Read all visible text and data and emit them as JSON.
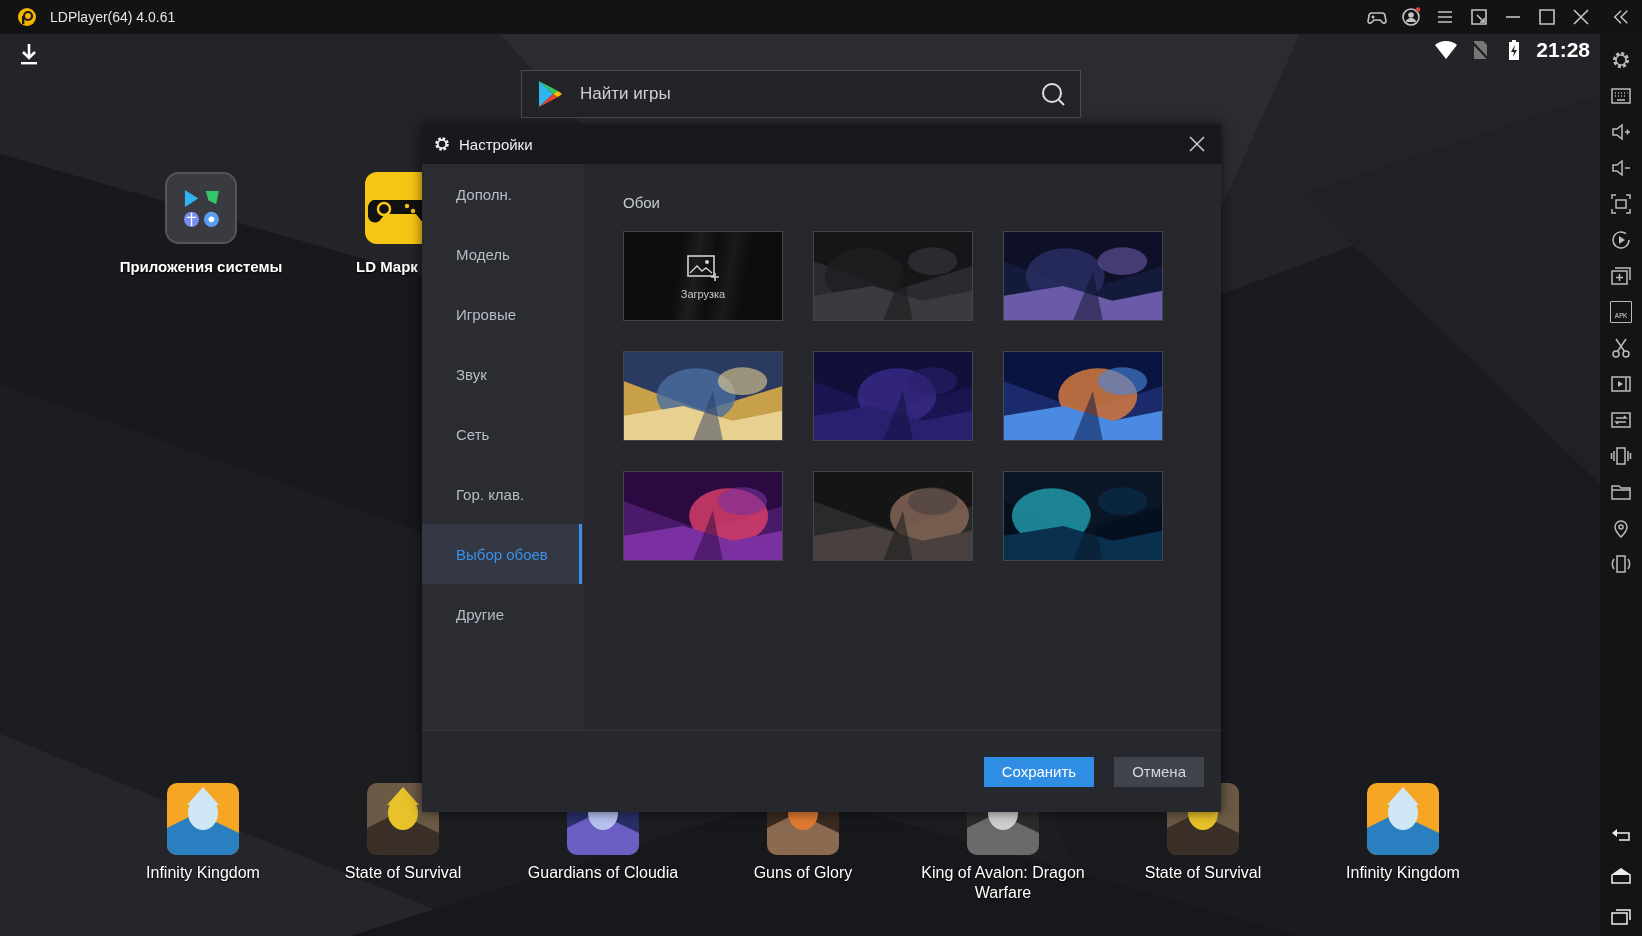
{
  "window": {
    "title": "LDPlayer(64) 4.0.61"
  },
  "status_bar": {
    "time": "21:28"
  },
  "search": {
    "placeholder": "Найти игры"
  },
  "desktop_apps": [
    {
      "label": "Приложения системы",
      "kind": "folder"
    },
    {
      "label": "LD Марк",
      "kind": "store"
    }
  ],
  "dock_apps": [
    {
      "label": "Infinity Kingdom",
      "kind": "picture"
    },
    {
      "label": "State of Survival",
      "kind": "picture"
    },
    {
      "label": "Guardians of Cloudia",
      "kind": "picture"
    },
    {
      "label": "Guns of Glory",
      "kind": "picture"
    },
    {
      "label": "King of Avalon: Dragon Warfare",
      "kind": "picture"
    },
    {
      "label": "State of Survival",
      "kind": "picture"
    },
    {
      "label": "Infinity Kingdom",
      "kind": "picture"
    }
  ],
  "side_toolbar": {
    "apk_label": "APK"
  },
  "settings": {
    "title": "Настройки",
    "nav": [
      {
        "label": "Дополн.",
        "selected": false
      },
      {
        "label": "Модель",
        "selected": false
      },
      {
        "label": "Игровые",
        "selected": false
      },
      {
        "label": "Звук",
        "selected": false
      },
      {
        "label": "Сеть",
        "selected": false
      },
      {
        "label": "Гор. клав.",
        "selected": false
      },
      {
        "label": "Выбор обоев",
        "selected": true
      },
      {
        "label": "Другие",
        "selected": false
      }
    ],
    "section_title": "Обои",
    "wallpapers": [
      {
        "kind": "upload",
        "label": "Загрузка"
      },
      {
        "kind": "picture"
      },
      {
        "kind": "picture"
      },
      {
        "kind": "picture"
      },
      {
        "kind": "picture"
      },
      {
        "kind": "picture"
      },
      {
        "kind": "picture"
      },
      {
        "kind": "picture"
      },
      {
        "kind": "picture"
      }
    ],
    "buttons": [
      {
        "label": "Сохранить",
        "kind": "primary"
      },
      {
        "label": "Отмена",
        "kind": "secondary"
      }
    ]
  }
}
